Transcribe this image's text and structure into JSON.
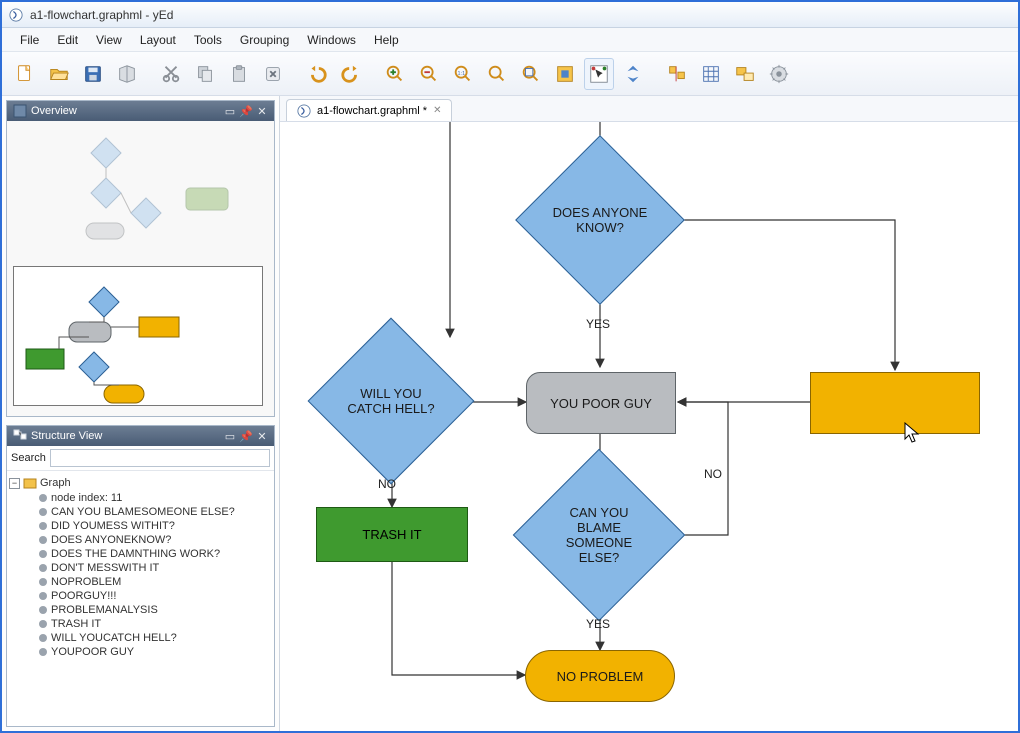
{
  "window": {
    "title": "a1-flowchart.graphml - yEd"
  },
  "menu": {
    "items": [
      "File",
      "Edit",
      "View",
      "Layout",
      "Tools",
      "Grouping",
      "Windows",
      "Help"
    ]
  },
  "toolbar_icons": [
    "new",
    "open",
    "save",
    "save-as",
    "cut",
    "copy",
    "paste",
    "delete",
    "undo",
    "redo",
    "zoom-in",
    "zoom-out",
    "zoom-1to1",
    "zoom-fit",
    "zoom-area",
    "fit-selection",
    "select-mode",
    "navigate",
    "align",
    "grid",
    "auto-layout",
    "properties"
  ],
  "tab": {
    "label": "a1-flowchart.graphml *"
  },
  "panels": {
    "overview": {
      "title": "Overview"
    },
    "structure": {
      "title": "Structure View",
      "search_label": "Search",
      "search_value": "",
      "root": "Graph",
      "node_index": "node index: 11",
      "nodes": [
        "CAN YOU BLAMESOMEONE ELSE?",
        "DID YOUMESS WITHIT?",
        "DOES ANYONEKNOW?",
        "DOES THE DAMNTHING WORK?",
        "DON'T MESSWITH IT",
        "NOPROBLEM",
        "POORGUY!!!",
        "PROBLEMANALYSIS",
        "TRASH IT",
        "WILL YOUCATCH HELL?",
        "YOUPOOR GUY"
      ]
    }
  },
  "flow": {
    "n_does_anyone": "DOES ANYONE KNOW?",
    "n_will_you": "WILL YOU CATCH HELL?",
    "n_poor_guy": "YOU POOR GUY",
    "n_trash": "TRASH IT",
    "n_blame": "CAN YOU BLAME SOMEONE ELSE?",
    "n_noproblem": "NO PROBLEM",
    "e_yes1": "YES",
    "e_yes2": "YES",
    "e_no1": "NO",
    "e_no2": "NO"
  }
}
